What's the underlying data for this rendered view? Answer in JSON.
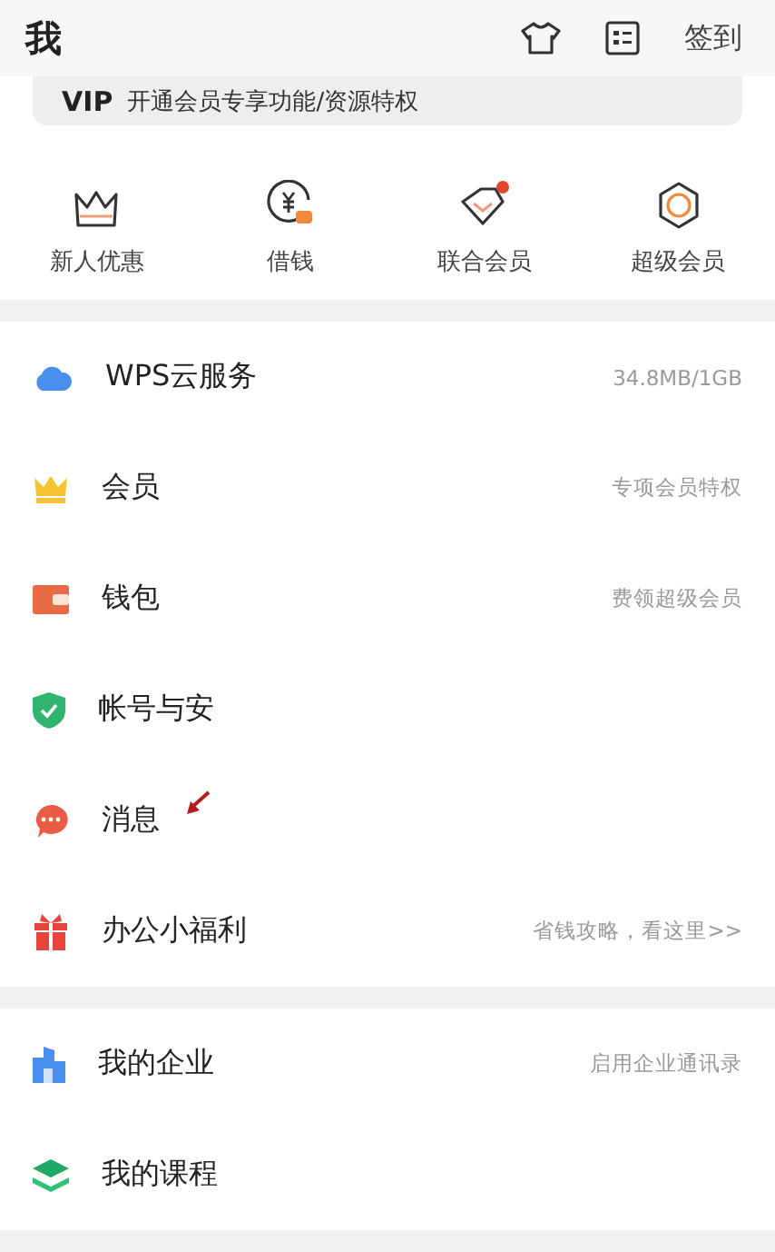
{
  "header": {
    "title": "我",
    "checkin": "签到"
  },
  "vip": {
    "badge": "VIP",
    "text": "开通会员专享功能/资源特权"
  },
  "quick": [
    {
      "kind": "crown",
      "label": "新人优惠"
    },
    {
      "kind": "loan",
      "label": "借钱"
    },
    {
      "kind": "diamond",
      "label": "联合会员"
    },
    {
      "kind": "hexagon",
      "label": "超级会员"
    }
  ],
  "groups": [
    [
      {
        "kind": "cloud",
        "label": "WPS云服务",
        "note": "34.8MB/1GB"
      },
      {
        "kind": "crown",
        "label": "会员",
        "note": "专项会员特权"
      },
      {
        "kind": "wallet",
        "label": "钱包",
        "note": "费领超级会员"
      },
      {
        "kind": "shield",
        "label": "帐号与安"
      },
      {
        "kind": "chat",
        "label": "消息"
      },
      {
        "kind": "gift",
        "label": "办公小福利",
        "note": "省钱攻略，看这里>>"
      }
    ],
    [
      {
        "kind": "building",
        "label": "我的企业",
        "note": "启用企业通讯录"
      },
      {
        "kind": "layers",
        "label": "我的课程"
      }
    ]
  ]
}
